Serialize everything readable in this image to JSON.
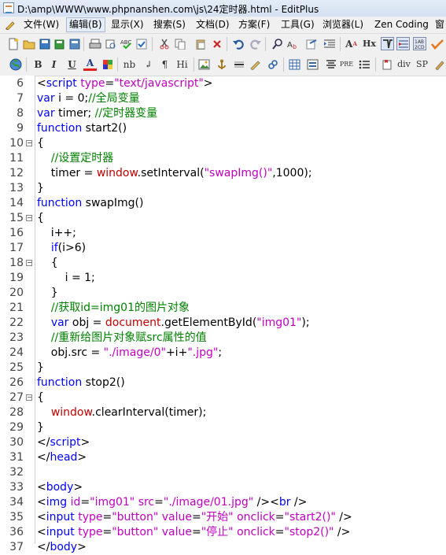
{
  "window": {
    "title": "D:\\amp\\WWW\\www.phpnanshen.com\\js\\24定时器.html - EditPlus"
  },
  "menu": [
    {
      "label": "文件(W)",
      "active": false
    },
    {
      "label": "编辑(B)",
      "active": true
    },
    {
      "label": "显示(X)",
      "active": false
    },
    {
      "label": "搜索(S)",
      "active": false
    },
    {
      "label": "文档(D)",
      "active": false
    },
    {
      "label": "方案(F)",
      "active": false
    },
    {
      "label": "工具(G)",
      "active": false
    },
    {
      "label": "浏览器(L)",
      "active": false
    },
    {
      "label": "Zen Coding",
      "active": false
    },
    {
      "label": "窗",
      "active": false
    }
  ],
  "toolbar1": [
    "new-file-icon",
    "open-folder-icon",
    "save-icon",
    "save-all-icon",
    "close-file-icon",
    "print-icon",
    "print-preview-icon",
    "spellcheck-icon",
    "cut-icon",
    "copy-icon",
    "paste-icon",
    "delete-icon",
    "undo-icon",
    "redo-icon",
    "find-icon",
    "replace-icon",
    "find-in-files-icon",
    "indent-icon",
    "font-size-icon",
    "hx-icon",
    "word-wrap-icon",
    "line-number-icon",
    "cursor-icon",
    "check-icon"
  ],
  "toolbar2_text": {
    "bold": "B",
    "italic": "I",
    "underline": "U",
    "fontcolor": "A",
    "nbsp": "nb",
    "br": "↲",
    "para": "¶",
    "hi": "Hi",
    "pre": "PRE",
    "div": "div",
    "sp": "SP"
  },
  "lines": [
    {
      "n": "6",
      "fold": false,
      "tokens": [
        [
          "",
          "<"
        ],
        [
          "kw",
          "script "
        ],
        [
          "str",
          "type"
        ],
        [
          "",
          "="
        ],
        [
          "str",
          "\"text/javascript\""
        ],
        [
          "",
          ">"
        ]
      ]
    },
    {
      "n": "7",
      "fold": false,
      "tokens": [
        [
          "kw",
          "var"
        ],
        [
          "",
          " i = 0;"
        ],
        [
          "cmt",
          "//全局变量"
        ]
      ]
    },
    {
      "n": "8",
      "fold": false,
      "tokens": [
        [
          "kw",
          "var"
        ],
        [
          "",
          " timer; "
        ],
        [
          "cmt",
          "//定时器变量"
        ]
      ]
    },
    {
      "n": "9",
      "fold": false,
      "tokens": [
        [
          "kw",
          "function"
        ],
        [
          "",
          " start2()"
        ]
      ]
    },
    {
      "n": "10",
      "fold": true,
      "tokens": [
        [
          "",
          "{"
        ]
      ]
    },
    {
      "n": "11",
      "fold": false,
      "tokens": [
        [
          "",
          "    "
        ],
        [
          "cmt",
          "//设置定时器"
        ]
      ]
    },
    {
      "n": "12",
      "fold": false,
      "tokens": [
        [
          "",
          "    timer = "
        ],
        [
          "obj",
          "window"
        ],
        [
          "",
          ".setInterval("
        ],
        [
          "str",
          "\"swapImg()\""
        ],
        [
          "",
          ",1000);"
        ]
      ]
    },
    {
      "n": "13",
      "fold": false,
      "tokens": [
        [
          "",
          "}"
        ]
      ]
    },
    {
      "n": "14",
      "fold": false,
      "tokens": [
        [
          "kw",
          "function"
        ],
        [
          "",
          " swapImg()"
        ]
      ]
    },
    {
      "n": "15",
      "fold": true,
      "tokens": [
        [
          "",
          "{"
        ]
      ]
    },
    {
      "n": "16",
      "fold": false,
      "tokens": [
        [
          "",
          "    i++;"
        ]
      ]
    },
    {
      "n": "17",
      "fold": false,
      "tokens": [
        [
          "",
          "    "
        ],
        [
          "kw",
          "if"
        ],
        [
          "",
          "(i>6)"
        ]
      ]
    },
    {
      "n": "18",
      "fold": true,
      "tokens": [
        [
          "",
          "    {"
        ]
      ]
    },
    {
      "n": "19",
      "fold": false,
      "tokens": [
        [
          "",
          "        i = 1;"
        ]
      ]
    },
    {
      "n": "20",
      "fold": false,
      "tokens": [
        [
          "",
          "    }"
        ]
      ]
    },
    {
      "n": "21",
      "fold": false,
      "tokens": [
        [
          "",
          "    "
        ],
        [
          "cmt",
          "//获取id=img01的图片对象"
        ]
      ]
    },
    {
      "n": "22",
      "fold": false,
      "tokens": [
        [
          "",
          "    "
        ],
        [
          "kw",
          "var"
        ],
        [
          "",
          " obj = "
        ],
        [
          "obj",
          "document"
        ],
        [
          "",
          ".getElementById("
        ],
        [
          "str",
          "\"img01\""
        ],
        [
          "",
          ");"
        ]
      ]
    },
    {
      "n": "23",
      "fold": false,
      "tokens": [
        [
          "",
          "    "
        ],
        [
          "cmt",
          "//重新给图片对象赋src属性的值"
        ]
      ]
    },
    {
      "n": "24",
      "fold": false,
      "tokens": [
        [
          "",
          "    obj.src = "
        ],
        [
          "str",
          "\"./image/0\""
        ],
        [
          "",
          "+i+"
        ],
        [
          "str",
          "\".jpg\""
        ],
        [
          "",
          ";"
        ]
      ]
    },
    {
      "n": "25",
      "fold": false,
      "tokens": [
        [
          "",
          "}"
        ]
      ]
    },
    {
      "n": "26",
      "fold": false,
      "tokens": [
        [
          "kw",
          "function"
        ],
        [
          "",
          " stop2()"
        ]
      ]
    },
    {
      "n": "27",
      "fold": true,
      "tokens": [
        [
          "",
          "{"
        ]
      ]
    },
    {
      "n": "28",
      "fold": false,
      "tokens": [
        [
          "",
          "    "
        ],
        [
          "obj",
          "window"
        ],
        [
          "",
          ".clearInterval(timer);"
        ]
      ]
    },
    {
      "n": "29",
      "fold": false,
      "tokens": [
        [
          "",
          "}"
        ]
      ]
    },
    {
      "n": "30",
      "fold": false,
      "tokens": [
        [
          "",
          "</"
        ],
        [
          "kw",
          "script"
        ],
        [
          "",
          ">"
        ]
      ]
    },
    {
      "n": "31",
      "fold": false,
      "tokens": [
        [
          "",
          "</"
        ],
        [
          "kw",
          "head"
        ],
        [
          "",
          ">"
        ]
      ]
    },
    {
      "n": "32",
      "fold": false,
      "tokens": []
    },
    {
      "n": "33",
      "fold": false,
      "tokens": [
        [
          "",
          "<"
        ],
        [
          "kw",
          "body"
        ],
        [
          "",
          ">"
        ]
      ]
    },
    {
      "n": "34",
      "fold": false,
      "tokens": [
        [
          "",
          "<"
        ],
        [
          "kw",
          "img "
        ],
        [
          "str",
          "id"
        ],
        [
          "",
          "="
        ],
        [
          "str",
          "\"img01\""
        ],
        [
          "",
          " "
        ],
        [
          "str",
          "src"
        ],
        [
          "",
          "="
        ],
        [
          "str",
          "\"./image/01.jpg\""
        ],
        [
          "",
          " /><"
        ],
        [
          "kw",
          "br"
        ],
        [
          "",
          " />"
        ]
      ]
    },
    {
      "n": "35",
      "fold": false,
      "tokens": [
        [
          "",
          "<"
        ],
        [
          "kw",
          "input "
        ],
        [
          "str",
          "type"
        ],
        [
          "",
          "="
        ],
        [
          "str",
          "\"button\""
        ],
        [
          "",
          " "
        ],
        [
          "str",
          "value"
        ],
        [
          "",
          "="
        ],
        [
          "str",
          "\"开始\""
        ],
        [
          "",
          " "
        ],
        [
          "str",
          "onclick"
        ],
        [
          "",
          "="
        ],
        [
          "str",
          "\"start2()\""
        ],
        [
          "",
          " />"
        ]
      ]
    },
    {
      "n": "36",
      "fold": false,
      "tokens": [
        [
          "",
          "<"
        ],
        [
          "kw",
          "input "
        ],
        [
          "str",
          "type"
        ],
        [
          "",
          "="
        ],
        [
          "str",
          "\"button\""
        ],
        [
          "",
          " "
        ],
        [
          "str",
          "value"
        ],
        [
          "",
          "="
        ],
        [
          "str",
          "\"停止\""
        ],
        [
          "",
          " "
        ],
        [
          "str",
          "onclick"
        ],
        [
          "",
          "="
        ],
        [
          "str",
          "\"stop2()\""
        ],
        [
          "",
          " />"
        ]
      ]
    },
    {
      "n": "37",
      "fold": false,
      "tokens": [
        [
          "",
          "</"
        ],
        [
          "kw",
          "body"
        ],
        [
          "",
          ">"
        ]
      ]
    }
  ]
}
